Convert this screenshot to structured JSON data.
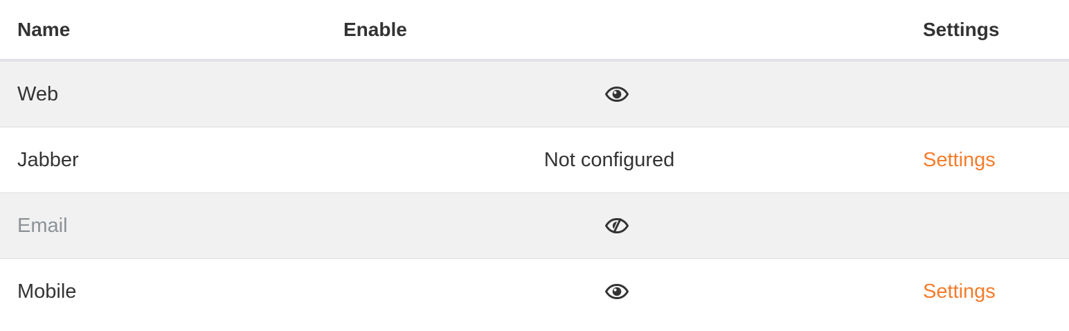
{
  "table": {
    "headers": {
      "name": "Name",
      "enable": "Enable",
      "settings": "Settings"
    },
    "rows": [
      {
        "name": "Web",
        "enable_icon": "eye-icon",
        "status": "",
        "settings": ""
      },
      {
        "name": "Jabber",
        "enable_icon": "",
        "status": "Not configured",
        "settings": "Settings"
      },
      {
        "name": "Email",
        "enable_icon": "eye-slash-icon",
        "status": "",
        "settings": ""
      },
      {
        "name": "Mobile",
        "enable_icon": "eye-icon",
        "status": "",
        "settings": "Settings"
      }
    ]
  },
  "colors": {
    "link": "#f57c2b",
    "text": "#333333",
    "disabled_text": "#8c9196",
    "stripe": "#f1f1f1"
  }
}
